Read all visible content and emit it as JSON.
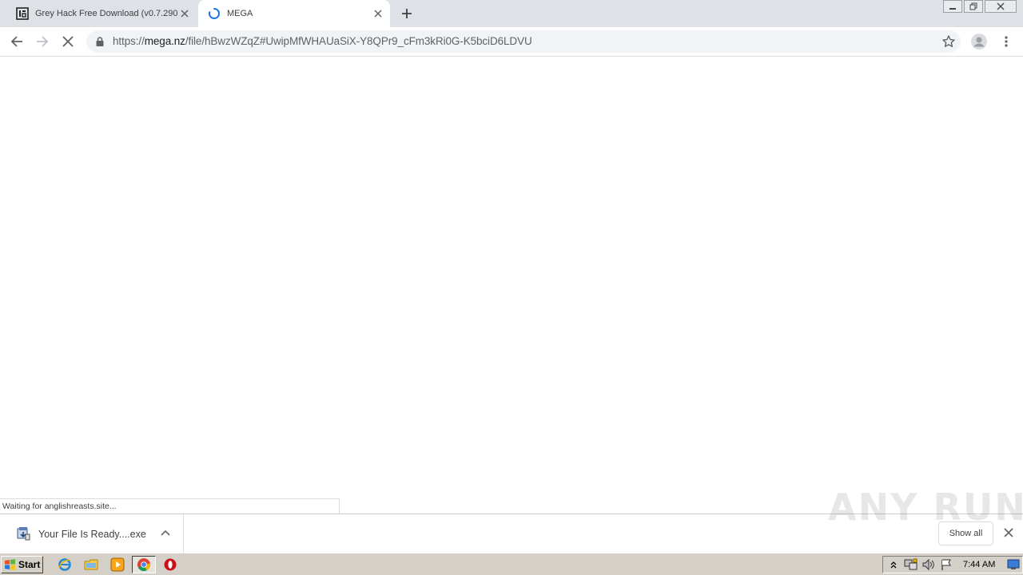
{
  "browser": {
    "tabs": [
      {
        "title": "Grey Hack Free Download (v0.7.290",
        "active": false
      },
      {
        "title": "MEGA",
        "active": true
      }
    ],
    "url": {
      "scheme": "https://",
      "host": "mega.nz",
      "path": "/file/hBwzWZqZ#UwipMfWHAUaSiX-Y8QPr9_cFm3kRi0G-K5bciD6LDVU"
    },
    "status_text": "Waiting for anglishreasts.site...",
    "loading": true
  },
  "download_shelf": {
    "items": [
      {
        "filename": "Your File Is Ready....exe",
        "icon": "installer-icon"
      }
    ],
    "show_all_label": "Show all"
  },
  "watermark": "ANY RUN",
  "taskbar": {
    "start_label": "Start",
    "apps": [
      "internet-explorer-icon",
      "file-explorer-icon",
      "media-player-icon",
      "chrome-icon",
      "opera-icon"
    ],
    "active_app": "chrome-icon",
    "clock": "7:44 AM"
  },
  "colors": {
    "tabstrip": "#dee1e6",
    "omnibox": "#f1f3f4",
    "taskbar": "#d4d0c8",
    "spinner": "#1a73e8"
  }
}
